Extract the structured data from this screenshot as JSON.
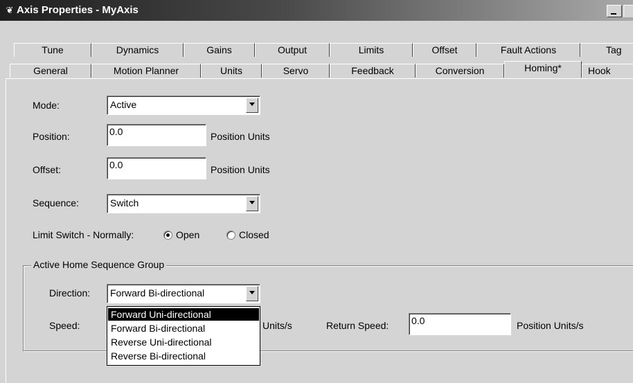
{
  "window": {
    "title": "Axis Properties - MyAxis",
    "icon": "axis-icon"
  },
  "tabs_row1": [
    {
      "label": "Tune"
    },
    {
      "label": "Dynamics"
    },
    {
      "label": "Gains"
    },
    {
      "label": "Output"
    },
    {
      "label": "Limits"
    },
    {
      "label": "Offset"
    },
    {
      "label": "Fault Actions"
    },
    {
      "label": "Tag"
    }
  ],
  "tabs_row2": [
    {
      "label": "General"
    },
    {
      "label": "Motion Planner"
    },
    {
      "label": "Units"
    },
    {
      "label": "Servo"
    },
    {
      "label": "Feedback"
    },
    {
      "label": "Conversion"
    },
    {
      "label": "Homing*",
      "selected": true
    },
    {
      "label": "Hook"
    }
  ],
  "form": {
    "mode": {
      "label": "Mode:",
      "value": "Active"
    },
    "position": {
      "label": "Position:",
      "value": "0.0",
      "unit": "Position Units"
    },
    "offset": {
      "label": "Offset:",
      "value": "0.0",
      "unit": "Position Units"
    },
    "sequence": {
      "label": "Sequence:",
      "value": "Switch"
    },
    "limit_switch": {
      "label": "Limit Switch - Normally:",
      "options": [
        "Open",
        "Closed"
      ],
      "selected": "Open"
    }
  },
  "group": {
    "title": "Active Home Sequence Group",
    "direction": {
      "label": "Direction:",
      "value": "Forward Bi-directional",
      "options": [
        "Forward Uni-directional",
        "Forward Bi-directional",
        "Reverse Uni-directional",
        "Reverse Bi-directional"
      ],
      "highlighted": "Forward Uni-directional"
    },
    "speed": {
      "label": "Speed:",
      "unit_partial": "Units/s"
    },
    "return_speed": {
      "label": "Return Speed:",
      "value": "0.0",
      "unit": "Position Units/s"
    }
  }
}
